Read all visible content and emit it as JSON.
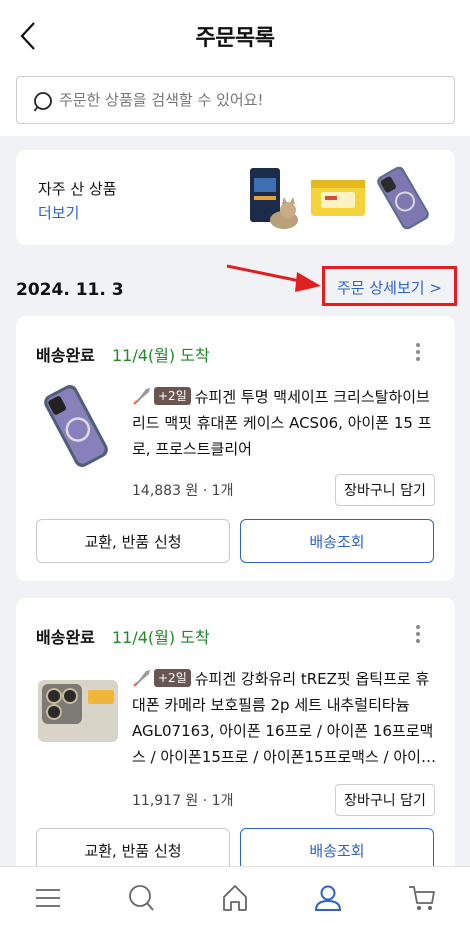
{
  "header": {
    "title": "주문목록"
  },
  "search": {
    "placeholder": "주문한 상품을 검색할 수 있어요!"
  },
  "frequent": {
    "title": "자주 산 상품",
    "more_label": "더보기"
  },
  "order_group": {
    "date": "2024. 11. 3",
    "detail_label": "주문 상세보기 >"
  },
  "orders": [
    {
      "status": "배송완료",
      "arrival": "11/4(월) 도착",
      "badge": "+2일",
      "name": "슈피겐 투명 맥세이프 크리스탈하이브리드 맥핏 휴대폰 케이스 ACS06, 아이폰 15 프로, 프로스트클리어",
      "price": "14,883 원 · 1개",
      "cart_label": "장바구니 담기",
      "exchange_label": "교환, 반품 신청",
      "track_label": "배송조회"
    },
    {
      "status": "배송완료",
      "arrival": "11/4(월) 도착",
      "badge": "+2일",
      "name": "슈피겐 강화유리 tREZ핏 옵틱프로 휴대폰 카메라 보호필름 2p 세트 내추럴티타늄 AGL07163, 아이폰 16프로 / 아이폰 16프로맥스 / 아이폰15프로 / 아이폰15프로맥스 / 아이…",
      "price": "11,917 원 · 1개",
      "cart_label": "장바구니 담기",
      "exchange_label": "교환, 반품 신청",
      "track_label": "배송조회"
    }
  ],
  "colors": {
    "accent": "#2d63c8",
    "arrival": "#1f8a26",
    "highlight": "#e02020"
  },
  "icons": {
    "back": "chevron-left-icon",
    "search": "search-icon",
    "more": "more-vertical-icon",
    "nav": [
      "menu-icon",
      "search-icon",
      "home-icon",
      "user-icon",
      "cart-icon"
    ]
  }
}
